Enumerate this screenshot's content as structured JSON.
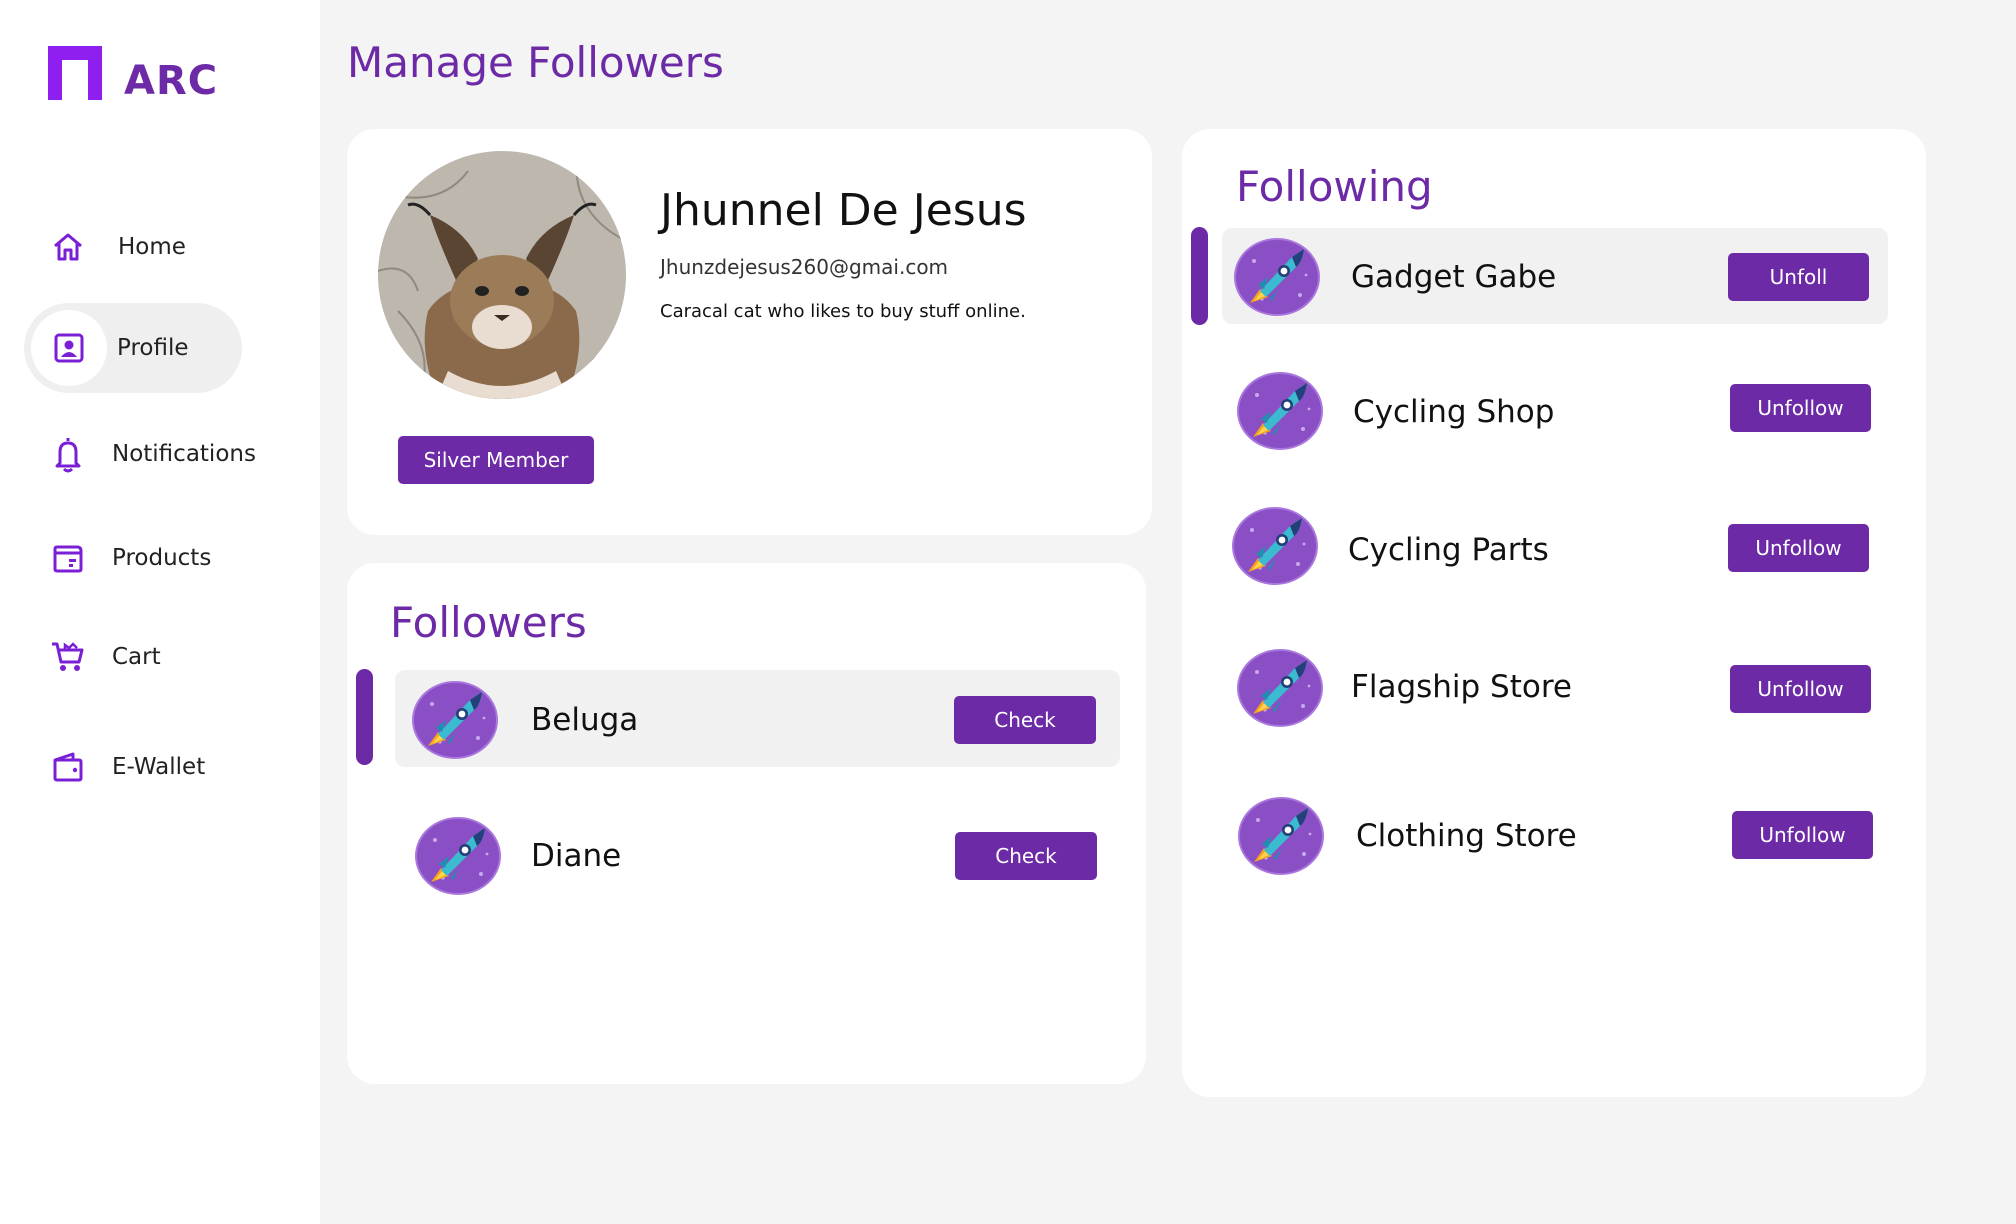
{
  "app": {
    "logo_text": "ARC",
    "accent": "#6d2aa6"
  },
  "sidebar": {
    "items": [
      {
        "label": "Home",
        "icon": "home-icon"
      },
      {
        "label": "Profile",
        "icon": "profile-icon",
        "active": true
      },
      {
        "label": "Notifications",
        "icon": "bell-icon"
      },
      {
        "label": "Products",
        "icon": "products-icon"
      },
      {
        "label": "Cart",
        "icon": "cart-icon"
      },
      {
        "label": "E-Wallet",
        "icon": "wallet-icon"
      }
    ]
  },
  "page": {
    "title": "Manage Followers"
  },
  "profile": {
    "name": "Jhunnel De Jesus",
    "email": "Jhunzdejesus260@gmai.com",
    "bio": "Caracal cat who likes to buy stuff online.",
    "badge": "Silver Member",
    "avatar_icon": "caracal-avatar"
  },
  "followers": {
    "title": "Followers",
    "items": [
      {
        "name": "Beluga",
        "button": "Check",
        "selected": true,
        "icon": "rocket-avatar-icon"
      },
      {
        "name": "Diane",
        "button": "Check",
        "icon": "rocket-avatar-icon"
      }
    ]
  },
  "following": {
    "title": "Following",
    "items": [
      {
        "name": "Gadget Gabe",
        "button": "Unfoll",
        "selected": true,
        "icon": "rocket-avatar-icon"
      },
      {
        "name": "Cycling Shop",
        "button": "Unfollow",
        "icon": "rocket-avatar-icon"
      },
      {
        "name": "Cycling Parts",
        "button": "Unfollow",
        "icon": "rocket-avatar-icon"
      },
      {
        "name": "Flagship Store",
        "button": "Unfollow",
        "icon": "rocket-avatar-icon"
      },
      {
        "name": "Clothing Store",
        "button": "Unfollow",
        "icon": "rocket-avatar-icon"
      }
    ]
  }
}
